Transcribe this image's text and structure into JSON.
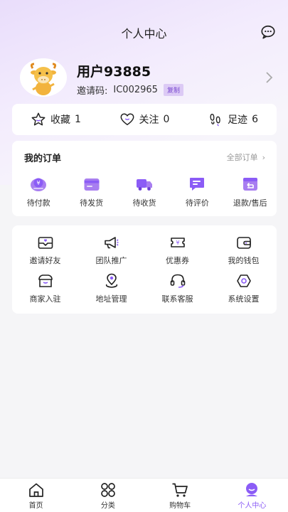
{
  "header": {
    "title": "个人中心"
  },
  "profile": {
    "username": "用户93885",
    "invite_label": "邀请码:",
    "invite_code": "IC002965",
    "copy_label": "复制"
  },
  "stats": [
    {
      "label": "收藏",
      "count": "1",
      "icon": "star-icon"
    },
    {
      "label": "关注",
      "count": "0",
      "icon": "heart-icon"
    },
    {
      "label": "足迹",
      "count": "6",
      "icon": "footprint-icon"
    }
  ],
  "orders": {
    "title": "我的订单",
    "all_label": "全部订单",
    "items": [
      {
        "label": "待付款",
        "icon": "wallet-yen-icon"
      },
      {
        "label": "待发货",
        "icon": "card-icon"
      },
      {
        "label": "待收货",
        "icon": "truck-icon"
      },
      {
        "label": "待评价",
        "icon": "comment-icon"
      },
      {
        "label": "退款/售后",
        "icon": "return-icon"
      }
    ]
  },
  "services": [
    {
      "label": "邀请好友",
      "icon": "envelope-heart-icon"
    },
    {
      "label": "团队推广",
      "icon": "megaphone-icon"
    },
    {
      "label": "优惠券",
      "icon": "ticket-icon"
    },
    {
      "label": "我的钱包",
      "icon": "wallet-icon"
    },
    {
      "label": "商家入驻",
      "icon": "shop-icon"
    },
    {
      "label": "地址管理",
      "icon": "location-icon"
    },
    {
      "label": "联系客服",
      "icon": "headset-icon"
    },
    {
      "label": "系统设置",
      "icon": "settings-icon"
    }
  ],
  "tabbar": [
    {
      "label": "首页",
      "icon": "home-icon",
      "active": false
    },
    {
      "label": "分类",
      "icon": "category-icon",
      "active": false
    },
    {
      "label": "购物车",
      "icon": "cart-icon",
      "active": false
    },
    {
      "label": "个人中心",
      "icon": "user-icon",
      "active": true
    }
  ],
  "colors": {
    "accent": "#8b5cf6",
    "accent_light": "#dccaf5"
  }
}
